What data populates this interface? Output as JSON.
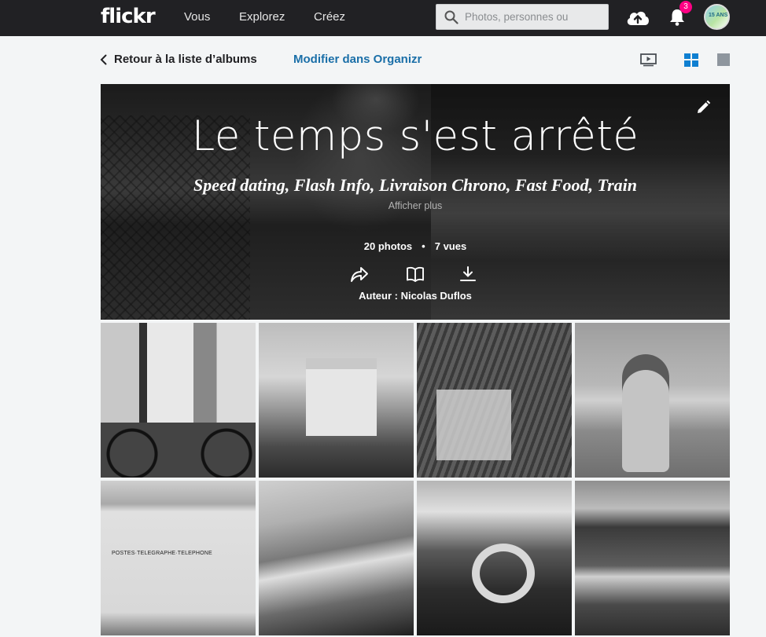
{
  "nav": {
    "logo": "flickr",
    "links": [
      "Vous",
      "Explorez",
      "Créez"
    ],
    "search_placeholder": "Photos, personnes ou",
    "notifications_count": "3",
    "avatar_text": "15 ANS"
  },
  "subnav": {
    "back_label": "Retour à la liste d’albums",
    "organizr_label": "Modifier dans Organizr"
  },
  "album": {
    "title": "Le temps s'est arrêté",
    "subtitle": "Speed dating, Flash Info, Livraison Chrono, Fast Food, Train",
    "show_more": "Afficher plus",
    "photos": "20 photos",
    "views": "7 vues",
    "author": "Auteur : Nicolas Duflos"
  },
  "colors": {
    "topbar": "#212124",
    "accent_link": "#1a6fa8",
    "view_active": "#0e7fd1",
    "badge": "#ff0084"
  },
  "icons": [
    "search-icon",
    "upload-cloud-icon",
    "bell-icon",
    "chevron-left-icon",
    "slideshow-icon",
    "grid-view-icon",
    "single-view-icon",
    "pencil-icon",
    "share-icon",
    "book-icon",
    "download-icon"
  ],
  "photos": [
    {
      "name": "photo-woman-bicycle"
    },
    {
      "name": "photo-church"
    },
    {
      "name": "photo-market-stall"
    },
    {
      "name": "photo-child-beach"
    },
    {
      "name": "photo-post-office"
    },
    {
      "name": "photo-salt-marsh"
    },
    {
      "name": "photo-lifebuoy-boat"
    },
    {
      "name": "photo-harbor-boats"
    }
  ]
}
